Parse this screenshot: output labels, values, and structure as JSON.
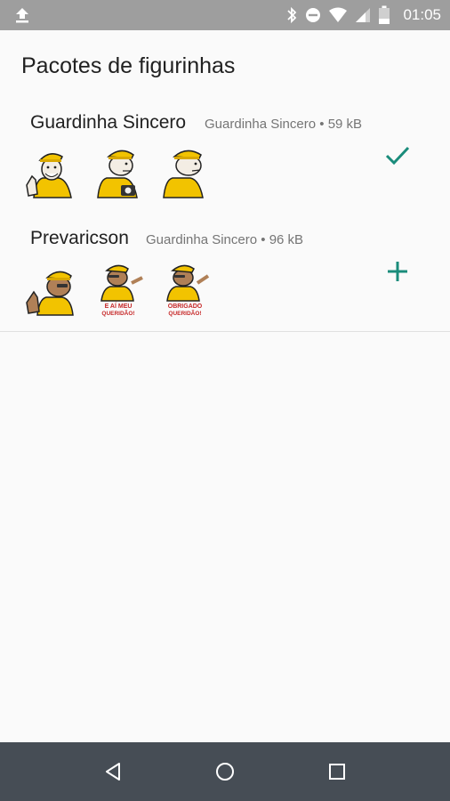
{
  "status_bar": {
    "time": "01:05",
    "icons": [
      "upload-icon",
      "bluetooth-icon",
      "do-not-disturb-icon",
      "wifi-icon",
      "signal-icon",
      "battery-icon"
    ]
  },
  "app": {
    "title": "Pacotes de figurinhas"
  },
  "packs": [
    {
      "name": "Guardinha Sincero",
      "publisher": "Guardinha Sincero",
      "separator": "•",
      "size": "59 kB",
      "action_icon": "check-icon",
      "sticker_count": 3
    },
    {
      "name": "Prevaricson",
      "publisher": "Guardinha Sincero",
      "separator": "•",
      "size": "96 kB",
      "action_icon": "add-icon",
      "sticker_count": 3,
      "sticker_texts": [
        "E AÍ MEU QUERIDÃO!",
        "OBRIGADO QUERIDÃO!"
      ]
    }
  ],
  "nav_bar": {
    "icons": [
      "back-icon",
      "home-icon",
      "recents-icon"
    ]
  },
  "colors": {
    "accent": "#1a8c7b",
    "status_bar": "#9e9e9e",
    "nav_bar": "#464d55",
    "sticker_yellow": "#f2c300"
  }
}
